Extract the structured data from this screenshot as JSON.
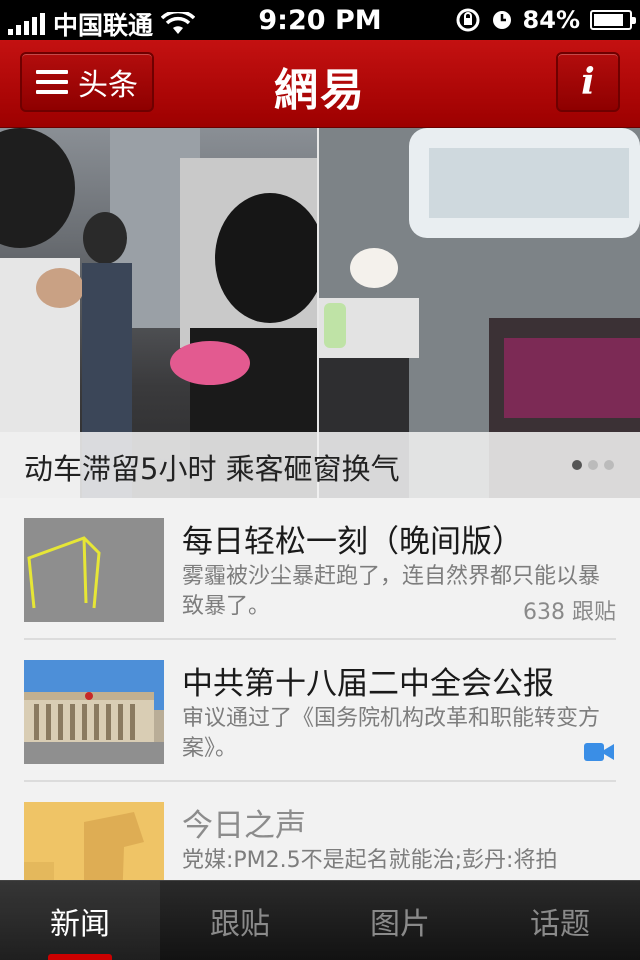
{
  "status_bar": {
    "carrier": "中国联通",
    "time": "9:20 PM",
    "battery_percent": "84%",
    "battery_level": 0.84
  },
  "header": {
    "menu_label": "头条",
    "logo": "網易",
    "info_label": "i"
  },
  "hero": {
    "caption": "动车滞留5小时 乘客砸窗换气",
    "page_count": 3,
    "active_page": 0
  },
  "news": [
    {
      "title": "每日轻松一刻（晚间版）",
      "desc": "雾霾被沙尘暴赶跑了，连自然界都只能以暴致暴了。",
      "meta": "638 跟贴",
      "thumb": "yellow-line-sculpture",
      "video": false
    },
    {
      "title": "中共第十八届二中全会公报",
      "desc": "审议通过了《国务院机构改革和职能转变方案》。",
      "meta": "",
      "thumb": "great-hall-building",
      "video": true
    },
    {
      "title": "今日之声",
      "desc": "党媒:PM2.5不是起名就能治;彭丹:将拍",
      "meta": "",
      "thumb": "smoggy-tower",
      "video": false
    }
  ],
  "tabs": [
    {
      "label": "新闻",
      "active": true
    },
    {
      "label": "跟贴",
      "active": false
    },
    {
      "label": "图片",
      "active": false
    },
    {
      "label": "话题",
      "active": false
    }
  ],
  "colors": {
    "brand_red": "#b30d0d",
    "video_blue": "#3a8ee6"
  }
}
